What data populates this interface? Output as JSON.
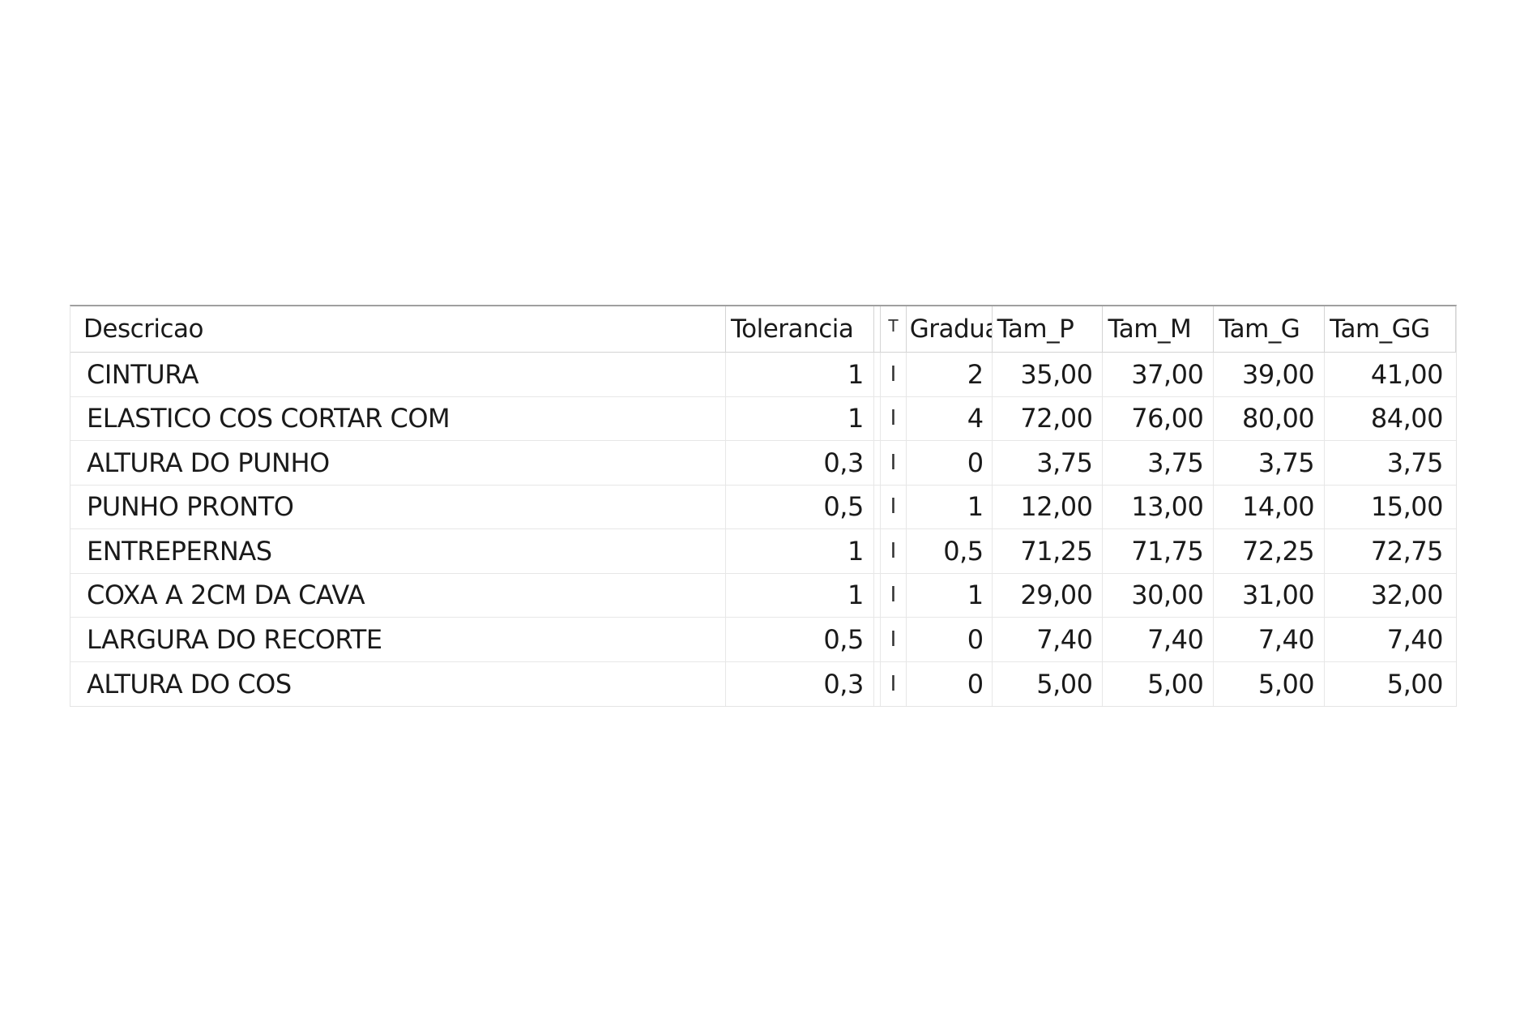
{
  "table": {
    "columns": [
      "Descricao",
      "Tolerancia",
      "",
      "T",
      "Gradua",
      "Tam_P",
      "Tam_M",
      "Tam_G",
      "Tam_GG"
    ],
    "rows": [
      {
        "descricao": "CINTURA",
        "tolerancia": "1",
        "t": "I",
        "graduacao": "2",
        "tam_p": "35,00",
        "tam_m": "37,00",
        "tam_g": "39,00",
        "tam_gg": "41,00"
      },
      {
        "descricao": "ELASTICO COS CORTAR COM",
        "tolerancia": "1",
        "t": "I",
        "graduacao": "4",
        "tam_p": "72,00",
        "tam_m": "76,00",
        "tam_g": "80,00",
        "tam_gg": "84,00"
      },
      {
        "descricao": "ALTURA DO PUNHO",
        "tolerancia": "0,3",
        "t": "I",
        "graduacao": "0",
        "tam_p": "3,75",
        "tam_m": "3,75",
        "tam_g": "3,75",
        "tam_gg": "3,75"
      },
      {
        "descricao": "PUNHO PRONTO",
        "tolerancia": "0,5",
        "t": "I",
        "graduacao": "1",
        "tam_p": "12,00",
        "tam_m": "13,00",
        "tam_g": "14,00",
        "tam_gg": "15,00"
      },
      {
        "descricao": "ENTREPERNAS",
        "tolerancia": "1",
        "t": "I",
        "graduacao": "0,5",
        "tam_p": "71,25",
        "tam_m": "71,75",
        "tam_g": "72,25",
        "tam_gg": "72,75"
      },
      {
        "descricao": "COXA A 2CM DA CAVA",
        "tolerancia": "1",
        "t": "I",
        "graduacao": "1",
        "tam_p": "29,00",
        "tam_m": "30,00",
        "tam_g": "31,00",
        "tam_gg": "32,00"
      },
      {
        "descricao": "LARGURA DO RECORTE",
        "tolerancia": "0,5",
        "t": "I",
        "graduacao": "0",
        "tam_p": "7,40",
        "tam_m": "7,40",
        "tam_g": "7,40",
        "tam_gg": "7,40"
      },
      {
        "descricao": "ALTURA DO COS",
        "tolerancia": "0,3",
        "t": "I",
        "graduacao": "0",
        "tam_p": "5,00",
        "tam_m": "5,00",
        "tam_g": "5,00",
        "tam_gg": "5,00"
      }
    ]
  }
}
